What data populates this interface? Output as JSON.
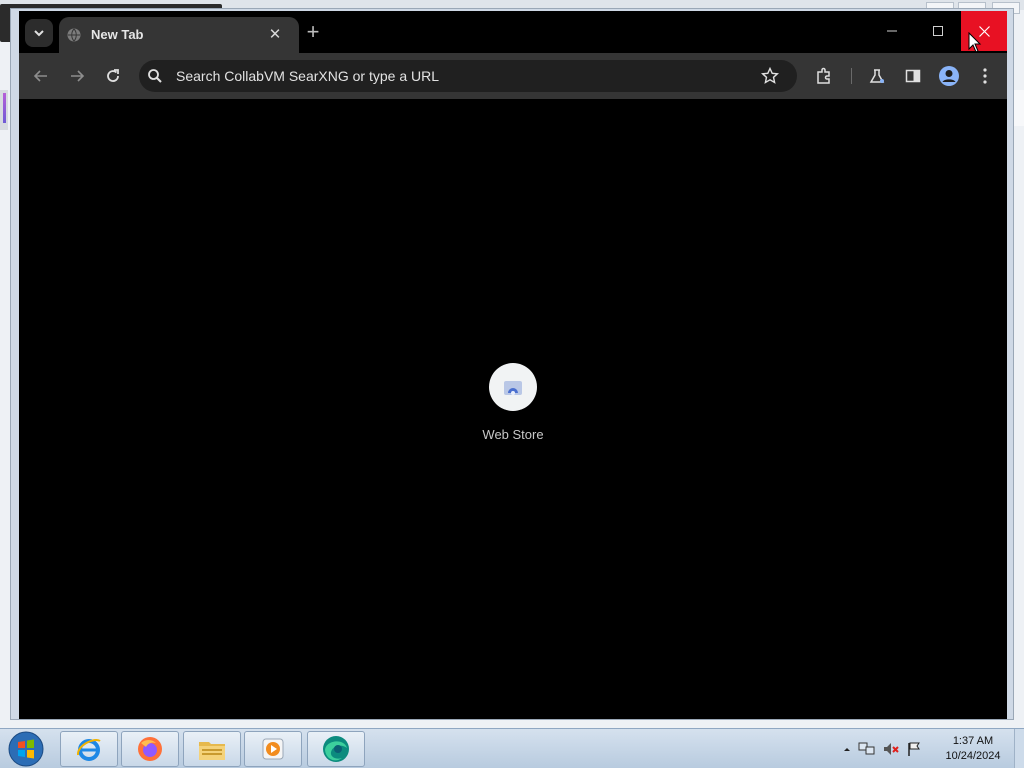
{
  "browser": {
    "tab": {
      "title": "New Tab",
      "close_glyph": "✕"
    },
    "new_tab_glyph": "+",
    "omnibox": {
      "placeholder": "Search CollabVM SearXNG or type a URL"
    },
    "shortcuts": [
      {
        "label": "Web Store",
        "icon": "web-store-icon"
      }
    ],
    "window_buttons": [
      "minimize-icon",
      "maximize-icon",
      "close-icon"
    ],
    "colors": {
      "close_hover": "#e81123",
      "frame": "#000000",
      "toolbar": "#353535"
    }
  },
  "taskbar": {
    "apps": [
      "internet-explorer-icon",
      "firefox-icon",
      "file-explorer-icon",
      "media-player-icon",
      "edge-icon"
    ],
    "clock": {
      "time": "1:37 AM",
      "date": "10/24/2024"
    }
  }
}
